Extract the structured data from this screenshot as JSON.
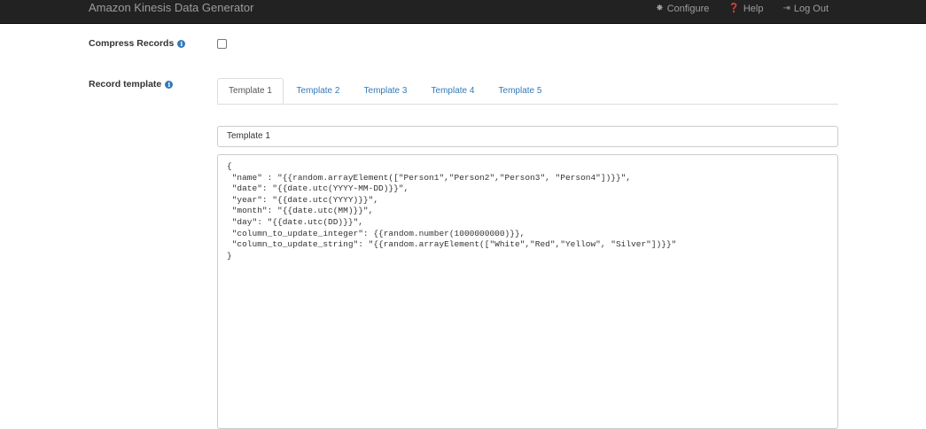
{
  "navbar": {
    "brand": "Amazon Kinesis Data Generator",
    "links": [
      {
        "label": "Configure",
        "icon": "gear-icon"
      },
      {
        "label": "Help",
        "icon": "question-circle-icon"
      },
      {
        "label": "Log Out",
        "icon": "logout-icon"
      }
    ]
  },
  "form": {
    "compress_label": "Compress Records",
    "compress_checked": false,
    "template_label": "Record template"
  },
  "tabs": [
    {
      "label": "Template 1",
      "active": true
    },
    {
      "label": "Template 2",
      "active": false
    },
    {
      "label": "Template 3",
      "active": false
    },
    {
      "label": "Template 4",
      "active": false
    },
    {
      "label": "Template 5",
      "active": false
    }
  ],
  "template": {
    "name": "Template 1",
    "lines": [
      "{",
      " \"name\" : \"{{random.arrayElement([\"Person1\",\"Person2\",\"Person3\", \"Person4\"])}}\",",
      " \"date\": \"{{date.utc(YYYY-MM-DD)}}\",",
      " \"year\": \"{{date.utc(YYYY)}}\",",
      " \"month\": \"{{date.utc(MM)}}\",",
      " \"day\": \"{{date.utc(DD)}}\",",
      " \"column_to_update_integer\": {{random.number(1000000000)}},",
      " \"column_to_update_string\": \"{{random.arrayElement([\"White\",\"Red\",\"Yellow\", \"Silver\"])}}\"",
      "}"
    ]
  }
}
